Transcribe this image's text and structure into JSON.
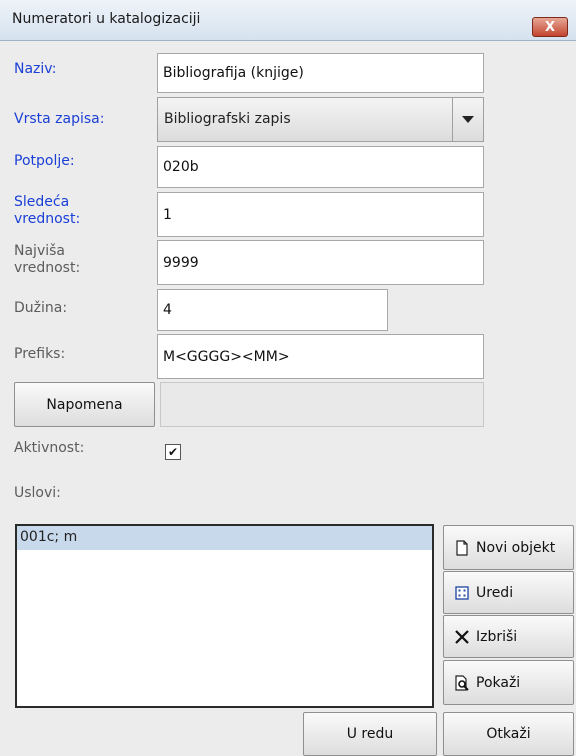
{
  "window": {
    "title": "Numeratori u katalogizaciji",
    "close_glyph": "X"
  },
  "form": {
    "naziv": {
      "label": "Naziv:",
      "value": "Bibliografija (knjige)"
    },
    "vrsta_zapisa": {
      "label": "Vrsta zapisa:",
      "value": "Bibliografski zapis"
    },
    "potpolje": {
      "label": "Potpolje:",
      "value": "020b"
    },
    "sledeca_vrednost": {
      "label_line1": "Sledeća",
      "label_line2": "vrednost:",
      "value": "1"
    },
    "najvisa_vrednost": {
      "label_line1": "Najviša",
      "label_line2": "vrednost:",
      "value": "9999"
    },
    "duzina": {
      "label": "Dužina:",
      "value": "4"
    },
    "prefiks": {
      "label": "Prefiks:",
      "value": "M<GGGG><MM>"
    },
    "napomena": {
      "button_label": "Napomena",
      "value": ""
    },
    "aktivnost": {
      "label": "Aktivnost:",
      "checked": true,
      "check_glyph": "✔"
    },
    "uslovi": {
      "label": "Uslovi:",
      "items": [
        "001c; m"
      ],
      "selected": "001c; m"
    }
  },
  "side_buttons": {
    "novi_objekt": "Novi objekt",
    "uredi": "Uredi",
    "izbrisi": "Izbriši",
    "pokazi": "Pokaži"
  },
  "footer": {
    "ok_label": "U redu",
    "cancel_label": "Otkaži"
  },
  "colors": {
    "required_label": "#1a3fd6",
    "optional_label": "#5c5c5c",
    "selection": "#c9d9ec"
  },
  "icons": [
    "close-icon",
    "dropdown-arrow-icon",
    "new-document-icon",
    "edit-icon",
    "delete-x-icon",
    "preview-icon"
  ]
}
